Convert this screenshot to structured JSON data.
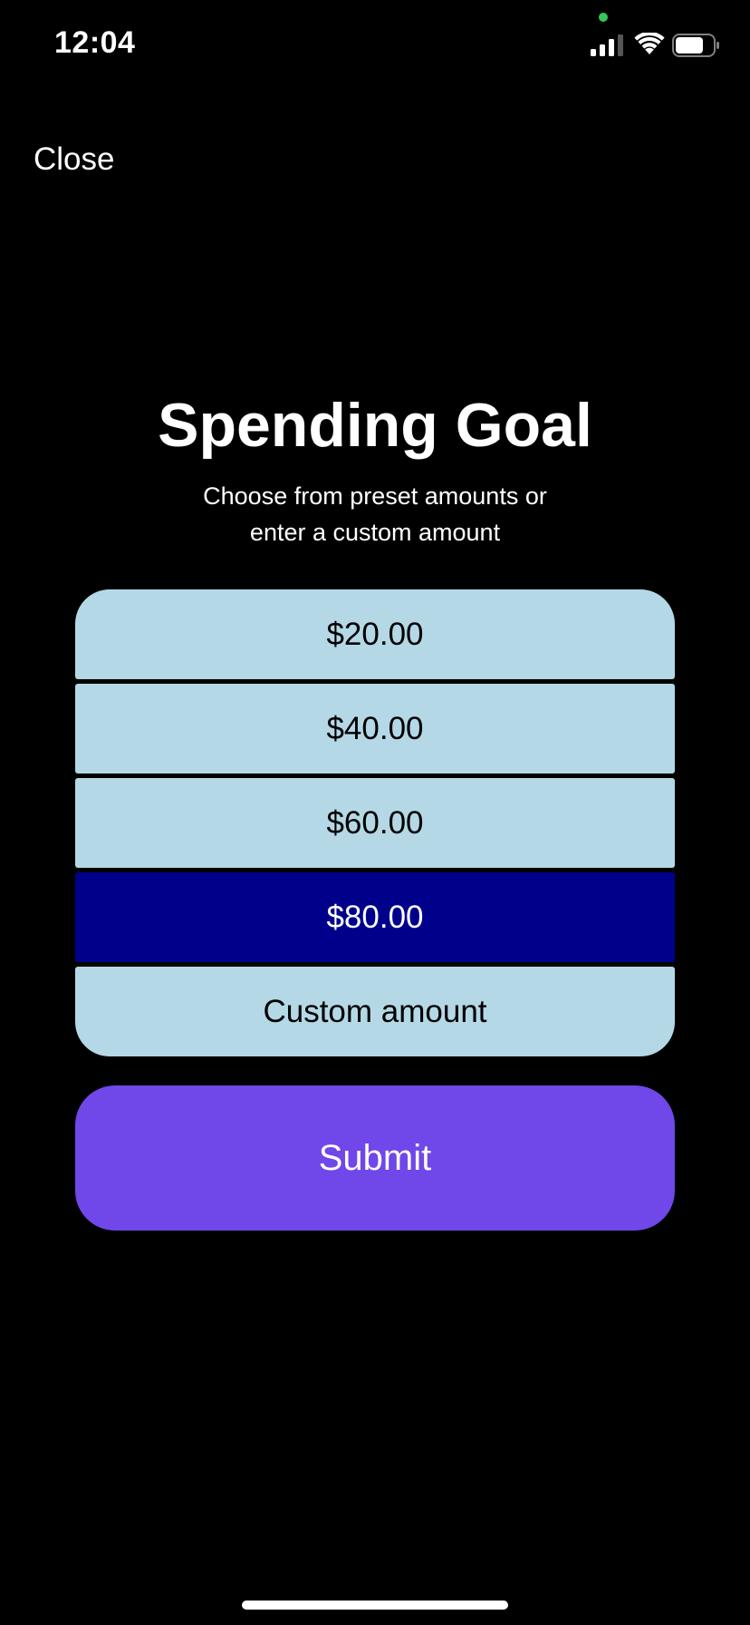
{
  "status_bar": {
    "time": "12:04",
    "icons": [
      "privacy-dot",
      "cellular-signal-icon",
      "wifi-icon",
      "battery-icon"
    ],
    "privacy_dot_color": "#34c759"
  },
  "header": {
    "close_label": "Close"
  },
  "main": {
    "title": "Spending Goal",
    "subtitle_line1": "Choose from preset amounts or",
    "subtitle_line2": "enter a custom amount",
    "options": [
      {
        "label": "$20.00",
        "selected": false
      },
      {
        "label": "$40.00",
        "selected": false
      },
      {
        "label": "$60.00",
        "selected": false
      },
      {
        "label": "$80.00",
        "selected": true
      },
      {
        "label": "Custom amount",
        "selected": false
      }
    ],
    "submit_label": "Submit"
  },
  "colors": {
    "background": "#000000",
    "option_background": "#b4d8e6",
    "option_selected_background": "#00008b",
    "submit_background": "#7047e8",
    "text_light": "#ffffff",
    "text_dark": "#000000"
  }
}
